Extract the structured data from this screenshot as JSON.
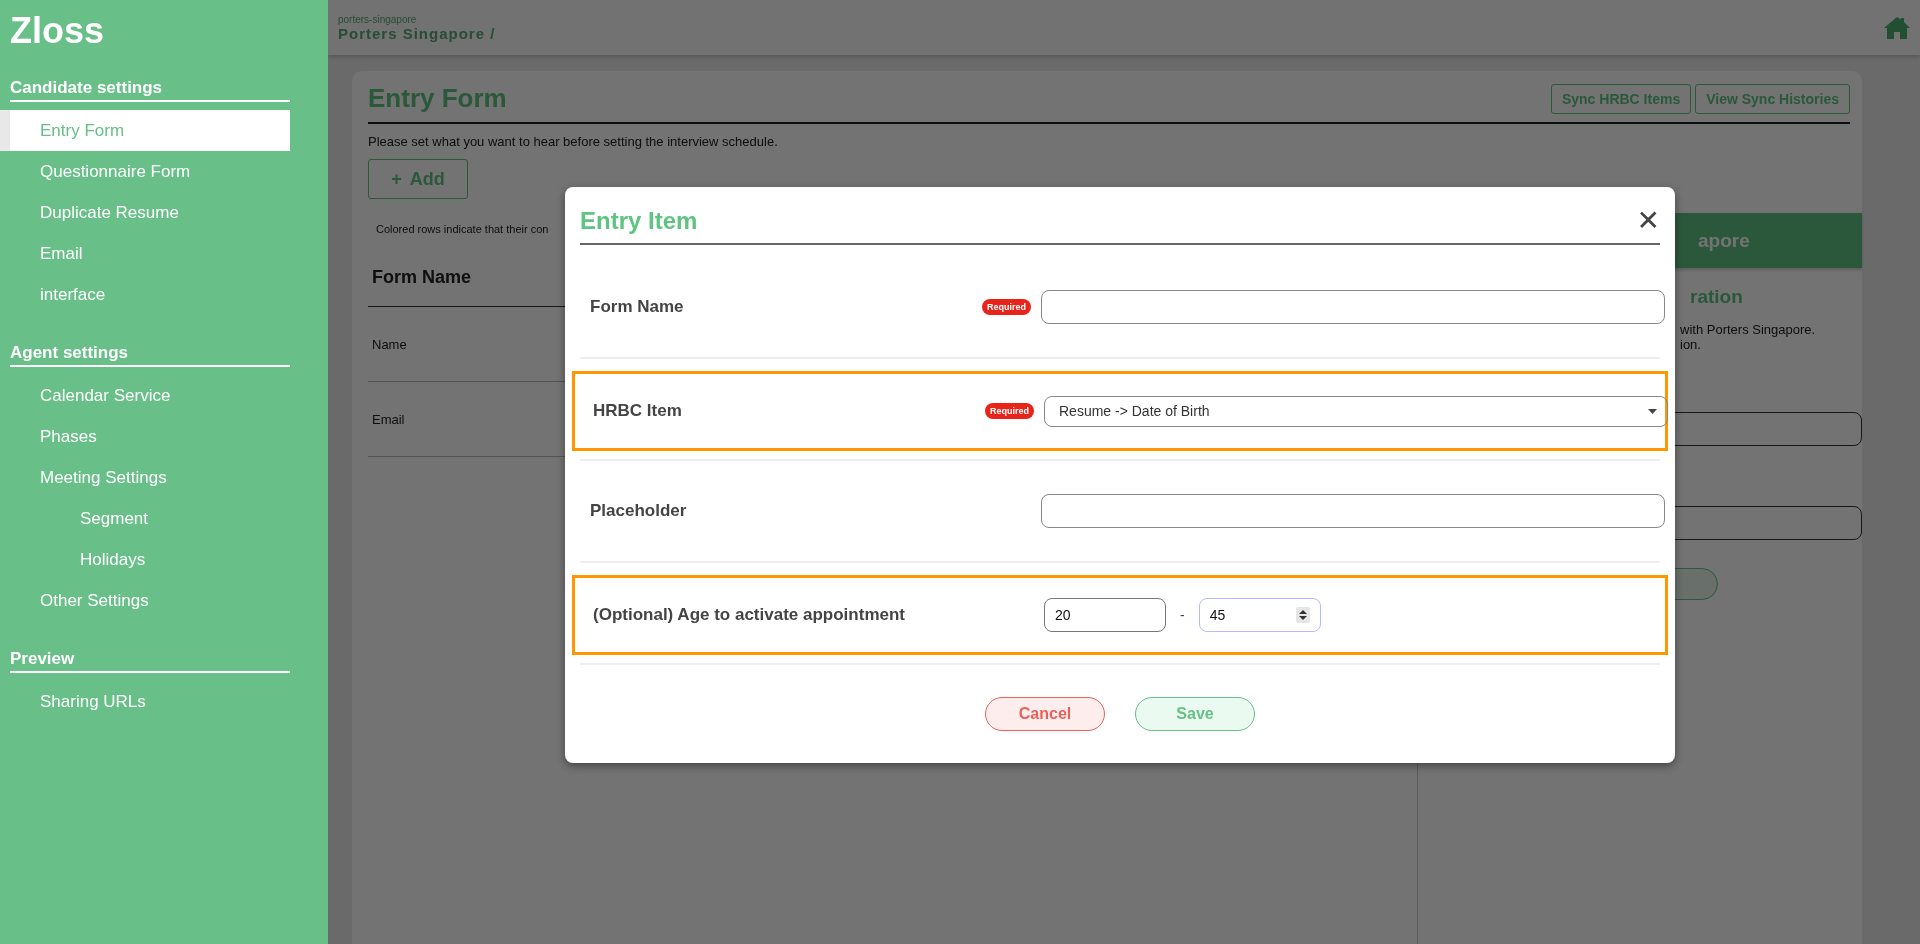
{
  "sidebar": {
    "brand": "Zloss",
    "sections": [
      {
        "title": "Candidate settings",
        "items": [
          {
            "label": "Entry Form",
            "selected": true
          },
          {
            "label": "Questionnaire Form",
            "selected": false
          },
          {
            "label": "Duplicate Resume",
            "selected": false
          },
          {
            "label": "Email",
            "selected": false
          },
          {
            "label": "interface",
            "selected": false
          }
        ]
      },
      {
        "title": "Agent settings",
        "items": [
          {
            "label": "Calendar Service",
            "selected": false
          },
          {
            "label": "Phases",
            "selected": false
          },
          {
            "label": "Meeting Settings",
            "selected": false,
            "children": [
              {
                "label": "Segment",
                "selected": false
              },
              {
                "label": "Holidays",
                "selected": false
              }
            ]
          },
          {
            "label": "Other Settings",
            "selected": false
          }
        ]
      },
      {
        "title": "Preview",
        "items": [
          {
            "label": "Sharing URLs",
            "selected": false
          }
        ]
      }
    ]
  },
  "header": {
    "subtitle": "porters-singapore",
    "title": "Porters Singapore /"
  },
  "page": {
    "title": "Entry Form",
    "buttons": [
      "Sync HRBC Items",
      "View Sync Histories"
    ],
    "description": "Please set what you want to hear before setting the interview schedule.",
    "add_button": {
      "icon": "+",
      "label": "Add"
    },
    "note": "Colored rows indicate that their con",
    "table": {
      "columns": [
        "Form Name"
      ],
      "rows": [
        [
          "Name"
        ],
        [
          "Email"
        ]
      ]
    },
    "side_card": {
      "header": "apore",
      "title": "ration",
      "lines": [
        "with Porters Singapore.",
        "ion."
      ]
    }
  },
  "modal": {
    "title": "Entry Item",
    "close": "✕",
    "rows": [
      {
        "kind": "text",
        "label": "Form Name",
        "required": "Required",
        "highlighted": false
      },
      {
        "kind": "select",
        "label": "HRBC Item",
        "required": "Required",
        "highlighted": true,
        "value": "Resume -> Date of Birth"
      },
      {
        "kind": "text",
        "label": "Placeholder",
        "highlighted": false
      },
      {
        "kind": "range",
        "label": "(Optional) Age to activate appointment",
        "highlighted": true,
        "separator": "-",
        "from": {
          "value": "20",
          "focused": false
        },
        "to": {
          "value": "45",
          "focused": true
        }
      }
    ],
    "buttons": [
      {
        "kind": "cancel",
        "label": "Cancel"
      },
      {
        "kind": "save",
        "label": "Save"
      }
    ]
  }
}
